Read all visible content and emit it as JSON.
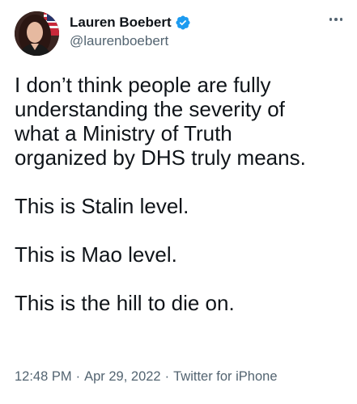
{
  "author": {
    "display_name": "Lauren Boebert",
    "handle": "@laurenboebert",
    "verified_icon": "verified-badge-icon",
    "avatar_icon": "profile-photo"
  },
  "menu": {
    "icon": "more-options-icon"
  },
  "tweet": {
    "paragraphs": [
      "I don’t think people are fully\nunderstanding the severity of\nwhat a Ministry of Truth\norganized by DHS truly means.",
      "This is Stalin level.",
      "This is Mao level.",
      "This is the hill to die on."
    ]
  },
  "meta": {
    "time": "12:48 PM",
    "separator": "·",
    "date": "Apr 29, 2022",
    "source": "Twitter for iPhone"
  },
  "colors": {
    "text_primary": "#0f1419",
    "text_secondary": "#536471",
    "verified_blue": "#1d9bf0"
  }
}
